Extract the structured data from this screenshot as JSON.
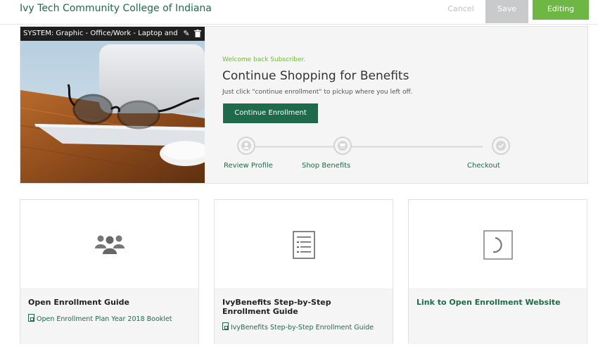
{
  "header": {
    "brand": "Ivy Tech Community College of Indiana",
    "cancel_label": "Cancel",
    "save_label": "Save",
    "editing_label": "Editing"
  },
  "hero": {
    "image_caption": "SYSTEM: Graphic - Office/Work - Laptop and Mc",
    "edit_icon": "pencil-icon",
    "delete_icon": "trash-icon",
    "welcome": "Welcome back Subscriber.",
    "title": "Continue Shopping for Benefits",
    "subtitle": "Just click \"continue enrollment\" to pickup where you left off.",
    "cta_label": "Continue Enrollment",
    "steps": [
      {
        "label": "Review Profile",
        "icon": "person-icon"
      },
      {
        "label": "Shop Benefits",
        "icon": "cart-icon"
      },
      {
        "label": "Checkout",
        "icon": "check-icon"
      }
    ]
  },
  "cards": [
    {
      "icon": "group-icon",
      "title": "Open Enrollment Guide",
      "link": "Open Enrollment Plan Year 2018 Booklet"
    },
    {
      "icon": "checklist-icon",
      "title": "IvyBenefits Step-by-Step Enrollment Guide",
      "link": "IvyBenefits Step-by-Step Enrollment Guide"
    },
    {
      "icon": "loading-icon",
      "title": "Link to Open Enrollment Website",
      "link": ""
    }
  ],
  "colors": {
    "brand_green": "#1d6b4a",
    "accent_green": "#6fb744",
    "save_gray": "#c9cacc"
  }
}
